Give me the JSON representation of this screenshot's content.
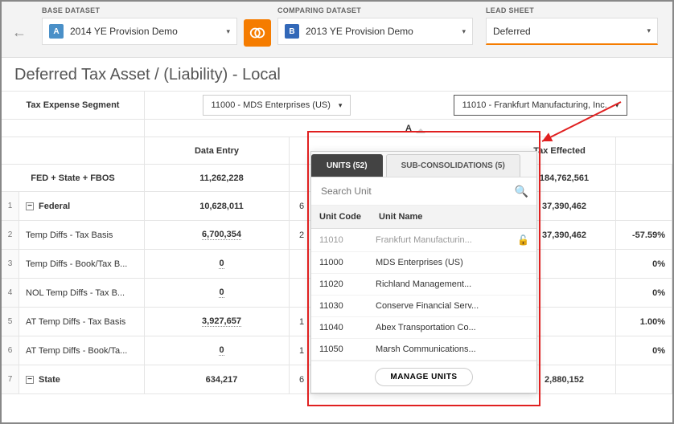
{
  "topbar": {
    "base_label": "BASE DATASET",
    "compare_label": "COMPARING DATASET",
    "lead_label": "LEAD SHEET",
    "base_badge": "A",
    "compare_badge": "B",
    "base_value": "2014 YE Provision Demo",
    "compare_value": "2013 YE Provision Demo",
    "lead_value": "Deferred"
  },
  "page_title": "Deferred Tax Asset / (Liability) - Local",
  "seg_label": "Tax Expense Segment",
  "entity_a": "11000 - MDS Enterprises (US)",
  "entity_b": "11010 - Frankfurt Manufacturing, Inc.",
  "ab_label": "A",
  "columns": {
    "data": "Data Entry",
    "tax": "Tax Effected"
  },
  "summary": {
    "name": "FED + State + FBOS",
    "data": "11,262,228",
    "tax": "184,762,561"
  },
  "rows": [
    {
      "n": "1",
      "name": "Federal",
      "exp": true,
      "data": "10,628,011",
      "data_u": false,
      "hid": "6",
      "tax": "37,390,462",
      "pct": ""
    },
    {
      "n": "2",
      "name": "Temp Diffs - Tax Basis",
      "data": "6,700,354",
      "data_u": true,
      "hid": "2",
      "tax": "37,390,462",
      "pct": "-57.59%"
    },
    {
      "n": "3",
      "name": "Temp Diffs - Book/Tax B...",
      "data": "0",
      "data_u": true,
      "hid": "",
      "tax": "",
      "pct": "0%"
    },
    {
      "n": "4",
      "name": "NOL Temp Diffs - Tax B...",
      "data": "0",
      "data_u": true,
      "hid": "",
      "tax": "",
      "pct": "0%"
    },
    {
      "n": "5",
      "name": "AT Temp Diffs - Tax Basis",
      "data": "3,927,657",
      "data_u": true,
      "hid": "1",
      "tax": "",
      "pct": "1.00%"
    },
    {
      "n": "6",
      "name": "AT Temp Diffs - Book/Ta...",
      "data": "0",
      "data_u": true,
      "hid": "1",
      "tax": "",
      "pct": "0%"
    },
    {
      "n": "7",
      "name": "State",
      "exp": true,
      "data": "634,217",
      "data_u": false,
      "hid": "6",
      "tax": "2,880,152",
      "pct": ""
    }
  ],
  "popover": {
    "tab_units": "UNITS (52)",
    "tab_sub": "SUB-CONSOLIDATIONS (5)",
    "search_placeholder": "Search Unit",
    "h_code": "Unit Code",
    "h_name": "Unit Name",
    "units": [
      {
        "code": "11010",
        "name": "Frankfurt Manufacturin...",
        "sel": true,
        "lock": true
      },
      {
        "code": "11000",
        "name": "MDS Enterprises (US)"
      },
      {
        "code": "11020",
        "name": "Richland Management..."
      },
      {
        "code": "11030",
        "name": "Conserve Financial Serv..."
      },
      {
        "code": "11040",
        "name": "Abex Transportation Co..."
      },
      {
        "code": "11050",
        "name": "Marsh Communications..."
      }
    ],
    "manage": "MANAGE UNITS"
  }
}
